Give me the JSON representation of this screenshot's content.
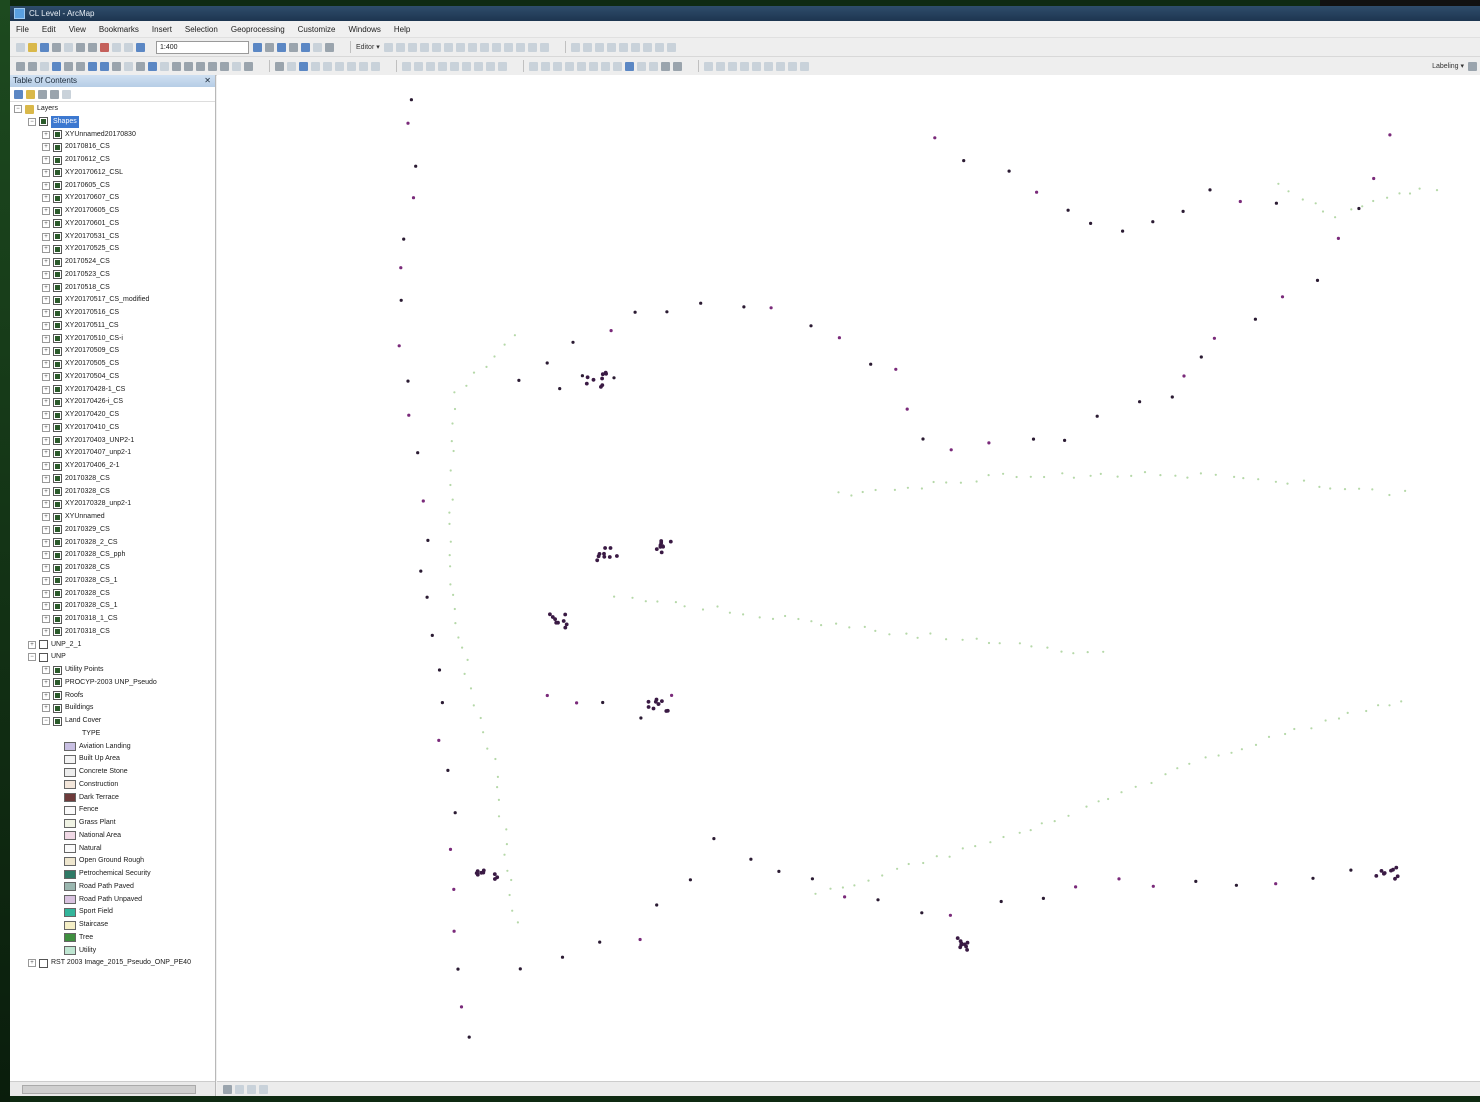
{
  "window": {
    "title": "CL Level - ArcMap"
  },
  "menu": [
    "File",
    "Edit",
    "View",
    "Bookmarks",
    "Insert",
    "Selection",
    "Geoprocessing",
    "Customize",
    "Windows",
    "Help"
  ],
  "toolbar": {
    "scale": "1:400",
    "editor_label": "Editor ▾",
    "labeling_label": "Labeling ▾"
  },
  "toc": {
    "title": "Table Of Contents",
    "root": "Layers",
    "selected_group": "Shapes",
    "layers": [
      "XYUnnamed20170830",
      "20170816_CS",
      "20170612_CS",
      "XY20170612_CSL",
      "20170605_CS",
      "XY20170607_CS",
      "XY20170605_CS",
      "XY20170601_CS",
      "XY20170531_CS",
      "XY20170525_CS",
      "20170524_CS",
      "20170523_CS",
      "20170518_CS",
      "XY20170517_CS_modified",
      "XY20170516_CS",
      "XY20170511_CS",
      "XY20170510_CS-i",
      "XY20170509_CS",
      "XY20170505_CS",
      "XY20170504_CS",
      "XY20170428-1_CS",
      "XY20170426-i_CS",
      "XY20170420_CS",
      "XY20170410_CS",
      "XY20170403_UNP2-1",
      "XY20170407_unp2-1",
      "XY20170406_2-1",
      "20170328_CS",
      "20170328_CS",
      "XY20170328_unp2-1",
      "XYUnnamed",
      "20170329_CS",
      "20170328_2_CS",
      "20170328_CS_pph",
      "20170328_CS",
      "20170328_CS_1",
      "20170328_CS",
      "20170328_CS_1",
      "20170318_1_CS",
      "20170318_CS"
    ],
    "unp21": "UNP_2_1",
    "unp": "UNP",
    "unp_children": [
      "Utility Points",
      "PROCYP-2003 UNP_Pseudo",
      "Roofs",
      "Buildings",
      "Land Cover"
    ],
    "type_label": "TYPE",
    "legend": [
      {
        "label": "Aviation Landing",
        "color": "#c9c0e3"
      },
      {
        "label": "Built Up Area",
        "color": "#f4f4f4"
      },
      {
        "label": "Concrete Stone",
        "color": "#ededed"
      },
      {
        "label": "Construction",
        "color": "#f3e6da"
      },
      {
        "label": "Dark Terrace",
        "color": "#6e3b3b"
      },
      {
        "label": "Fence",
        "color": "#fafafa"
      },
      {
        "label": "Grass Plant",
        "color": "#f0f3e4"
      },
      {
        "label": "National Area",
        "color": "#f1d9e6"
      },
      {
        "label": "Natural",
        "color": "#fbfbfb"
      },
      {
        "label": "Open Ground Rough",
        "color": "#efe7cf"
      },
      {
        "label": "Petrochemical Security",
        "color": "#2f7a66"
      },
      {
        "label": "Road Path Paved",
        "color": "#9bb7b0"
      },
      {
        "label": "Road Path Unpaved",
        "color": "#d9c3e0"
      },
      {
        "label": "Sport Field",
        "color": "#33b59b"
      },
      {
        "label": "Staircase",
        "color": "#f5efc6"
      },
      {
        "label": "Tree",
        "color": "#3f8f3f"
      },
      {
        "label": "Utility",
        "color": "#bfe6d2"
      }
    ],
    "image_layer": "RST 2003 Image_2015_Pseudo_ONP_PE40"
  }
}
